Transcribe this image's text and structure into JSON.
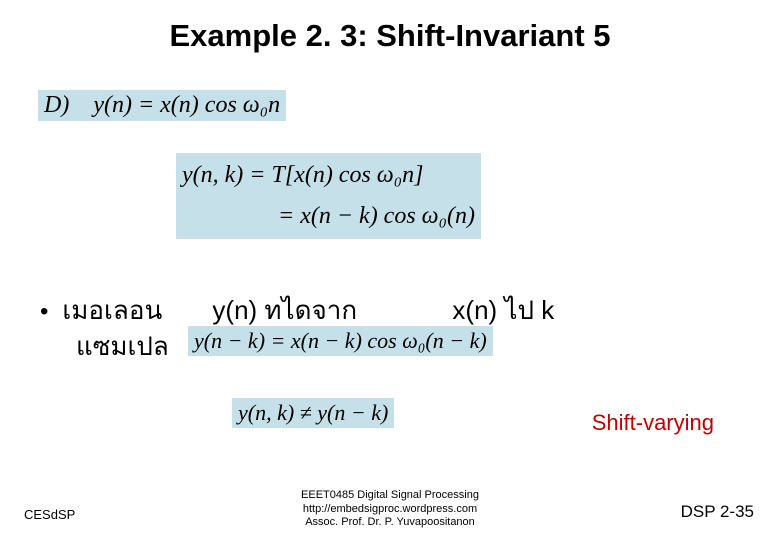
{
  "title": "Example 2. 3: Shift-Invariant 5",
  "eq1": "D) y(n) = x(n) cos ω₀n",
  "eq2_line1": "y(n, k) = T[x(n) cos ω₀n]",
  "eq2_line2": "    = x(n − k) cos ω₀(n)",
  "bullet": {
    "dot": "•",
    "thai1": "เมอเลอน",
    "mid": "y(n) ทไดจาก",
    "thai3": "x(n) ไป k",
    "thai2": "แซมเปล"
  },
  "eq3": "y(n − k) = x(n − k) cos ω₀(n − k)",
  "eq4": "y(n, k) ≠ y(n − k)",
  "shift_label": "Shift-varying",
  "footer": {
    "left": "CESdSP",
    "center_line1": "EEET0485 Digital Signal Processing",
    "center_line2": "http://embedsigproc.wordpress.com",
    "center_line3": "Assoc. Prof. Dr. P. Yuvapoositanon",
    "right": "DSP 2-35"
  }
}
